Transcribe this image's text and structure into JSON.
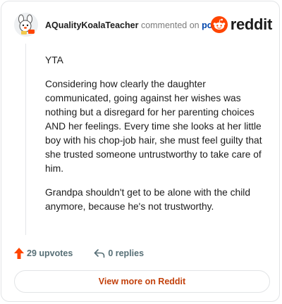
{
  "header": {
    "author": "AQualityKoalaTeacher",
    "commented_text": "commented on",
    "post_link": "post",
    "brand": "reddit"
  },
  "comment": {
    "paragraphs": [
      "YTA",
      "Considering how clearly the daughter communicated, going against her wishes was nothing but a disregard for her parenting choices AND her feelings. Every time she looks at her little boy with his chop-job hair, she must feel guilty that she trusted someone untrustworthy to take care of him.",
      "Grandpa shouldn't get to be alone with the child anymore, because he's not trustworthy."
    ]
  },
  "actions": {
    "upvotes": "29 upvotes",
    "replies": "0 replies"
  },
  "footer": {
    "view_more": "View more on Reddit"
  },
  "colors": {
    "brand": "#ff4500",
    "upvote_icon": "#ff4500",
    "post_link": "#0045ac",
    "view_more_text": "#c2410c"
  },
  "icons": {
    "avatar": "koala-avatar",
    "brand_logo": "reddit-alien-icon",
    "upvote": "upvote-arrow-icon",
    "reply": "reply-arrow-icon"
  }
}
